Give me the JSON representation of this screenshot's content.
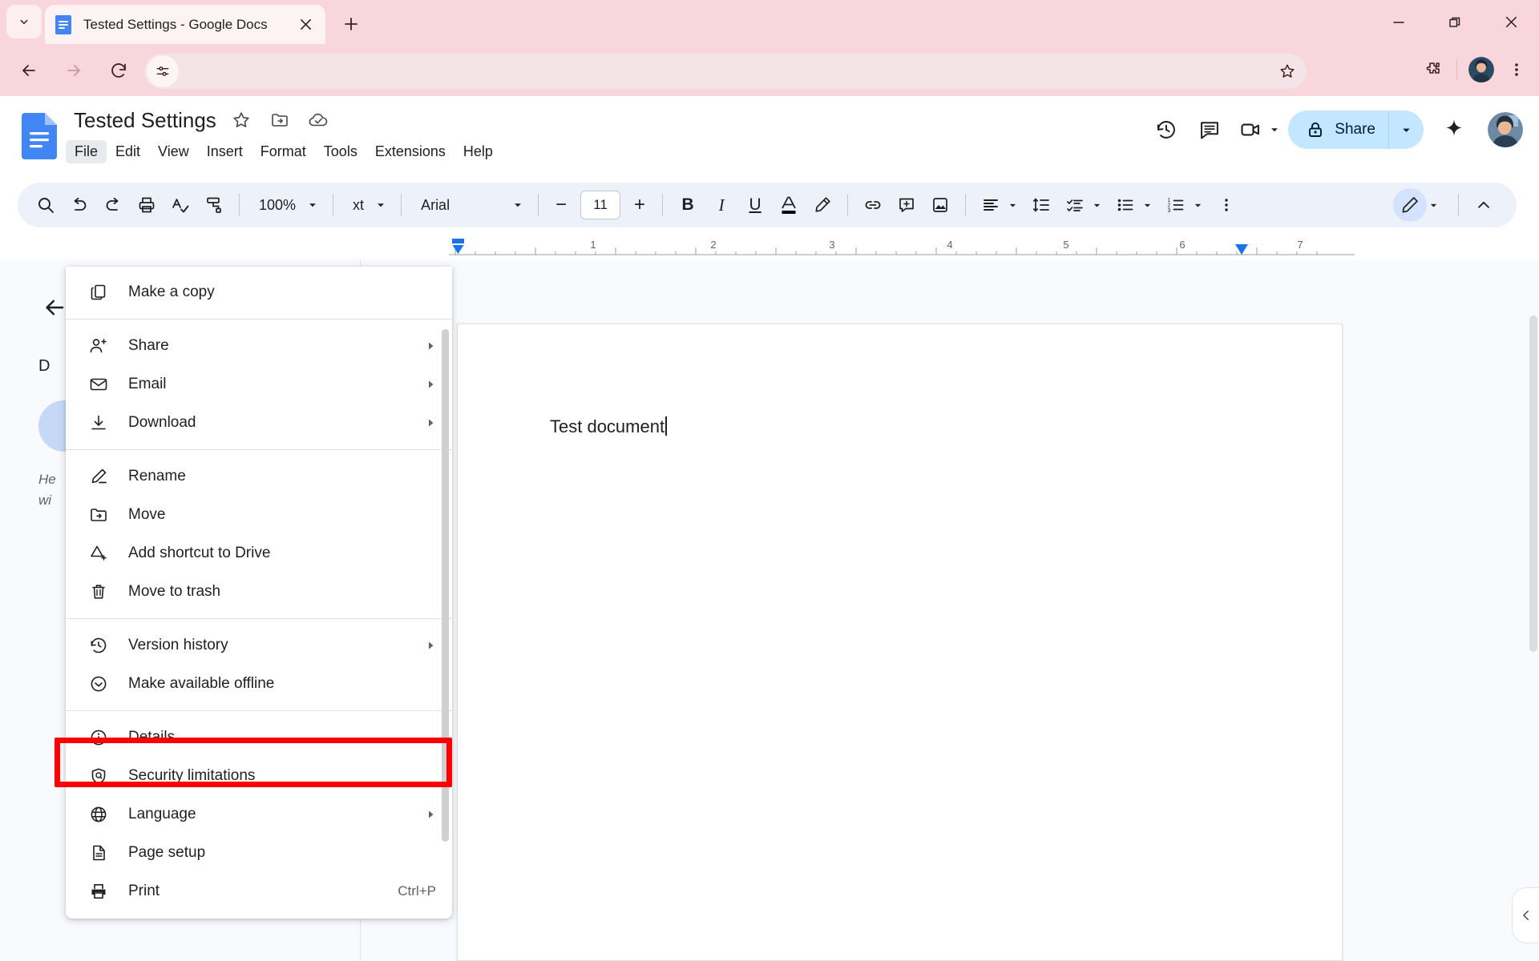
{
  "browser": {
    "tab": {
      "title": "Tested Settings - Google Docs",
      "favicon": "google-docs-favicon",
      "close_label": "✕"
    },
    "new_tab_label": "+",
    "tab_search_icon": "chevron-down-icon",
    "window_controls": {
      "minimize": "minimize-icon",
      "maximize": "restore-icon",
      "close": "close-icon"
    },
    "nav": {
      "back": "back-arrow-icon",
      "forward": "forward-arrow-icon",
      "reload": "reload-icon",
      "site_settings": "tune-icon"
    },
    "omnibox": {
      "value": "",
      "placeholder": ""
    },
    "omnibox_star": "bookmark-star-icon",
    "toolbar_right": {
      "extensions": "extensions-puzzle-icon",
      "profile": "browser-profile-avatar",
      "menu": "three-dot-menu-icon"
    }
  },
  "docs": {
    "logo": "google-docs-logo",
    "title": "Tested Settings",
    "title_icons": [
      "star-icon",
      "move-to-folder-icon",
      "saved-to-drive-cloud-icon"
    ],
    "menubar": [
      {
        "label": "File",
        "active": true
      },
      {
        "label": "Edit",
        "active": false
      },
      {
        "label": "View",
        "active": false
      },
      {
        "label": "Insert",
        "active": false
      },
      {
        "label": "Format",
        "active": false
      },
      {
        "label": "Tools",
        "active": false
      },
      {
        "label": "Extensions",
        "active": false
      },
      {
        "label": "Help",
        "active": false
      }
    ],
    "header_right": {
      "version_history": "version-history-clock-icon",
      "comments": "comment-icon",
      "meet": "video-camera-icon",
      "meet_caret": "chevron-down-icon",
      "share_label": "Share",
      "share_lock_icon": "lock-icon",
      "share_caret": "chevron-down-icon",
      "gemini": "gemini-spark-icon",
      "account_avatar": "account-avatar"
    },
    "toolbar": {
      "undo": "undo-icon",
      "redo": "redo-icon",
      "print": "print-icon",
      "spellcheck": "spellcheck-icon",
      "paint_format": "paint-format-icon",
      "zoom_value": "100%",
      "style_value": "Normal text",
      "style_value_clipped": "xt",
      "font_value": "Arial",
      "font_size": "11",
      "decrease_font": "−",
      "increase_font": "+",
      "bold": "B",
      "italic": "I",
      "underline": "U",
      "text_color": "text-color-icon",
      "highlight": "highlight-pen-icon",
      "insert_link": "link-icon",
      "add_comment": "add-comment-icon",
      "insert_image": "insert-image-icon",
      "align": "align-left-icon",
      "line_spacing": "line-spacing-icon",
      "checklist": "checklist-icon",
      "bulleted_list": "bulleted-list-icon",
      "numbered_list": "numbered-list-icon",
      "more_options": "three-dot-more-icon",
      "editing_mode": "edit-pencil-icon",
      "collapse": "chevron-up-icon"
    },
    "ruler": {
      "labels": [
        "1",
        "2",
        "3",
        "4",
        "5",
        "6",
        "7"
      ],
      "left_indent_marker": "left-indent-marker",
      "right_indent_marker": "right-indent-marker"
    },
    "side_panel": {
      "back_icon": "back-arrow-icon",
      "heading_clipped": "D",
      "pill_label": "",
      "hint_line1": "He",
      "hint_line2": "wi"
    },
    "document": {
      "text": "Test document",
      "cursor_visible": true
    },
    "expand_tab_icon": "chevron-left-icon"
  },
  "file_menu": {
    "groups": [
      {
        "items": [
          {
            "icon": "copy-icon",
            "label": "Make a copy",
            "submenu": false,
            "shortcut": ""
          }
        ]
      },
      {
        "items": [
          {
            "icon": "person-add-icon",
            "label": "Share",
            "submenu": true,
            "shortcut": ""
          },
          {
            "icon": "email-icon",
            "label": "Email",
            "submenu": true,
            "shortcut": ""
          },
          {
            "icon": "download-icon",
            "label": "Download",
            "submenu": true,
            "shortcut": ""
          }
        ]
      },
      {
        "items": [
          {
            "icon": "rename-pencil-icon",
            "label": "Rename",
            "submenu": false,
            "shortcut": ""
          },
          {
            "icon": "move-folder-icon",
            "label": "Move",
            "submenu": false,
            "shortcut": ""
          },
          {
            "icon": "add-shortcut-drive-icon",
            "label": "Add shortcut to Drive",
            "submenu": false,
            "shortcut": ""
          },
          {
            "icon": "trash-icon",
            "label": "Move to trash",
            "submenu": false,
            "shortcut": ""
          }
        ]
      },
      {
        "items": [
          {
            "icon": "version-history-icon",
            "label": "Version history",
            "submenu": true,
            "shortcut": ""
          },
          {
            "icon": "offline-check-icon",
            "label": "Make available offline",
            "submenu": false,
            "shortcut": ""
          }
        ]
      },
      {
        "items": [
          {
            "icon": "info-icon",
            "label": "Details",
            "submenu": false,
            "shortcut": ""
          },
          {
            "icon": "shield-icon",
            "label": "Security limitations",
            "submenu": false,
            "shortcut": ""
          },
          {
            "icon": "globe-icon",
            "label": "Language",
            "submenu": true,
            "shortcut": ""
          },
          {
            "icon": "page-setup-icon",
            "label": "Page setup",
            "submenu": false,
            "shortcut": "",
            "highlighted": true
          },
          {
            "icon": "printer-icon",
            "label": "Print",
            "submenu": false,
            "shortcut": "Ctrl+P"
          }
        ]
      }
    ]
  },
  "annotation": {
    "highlight_color": "#ff0000",
    "target": "Page setup"
  }
}
